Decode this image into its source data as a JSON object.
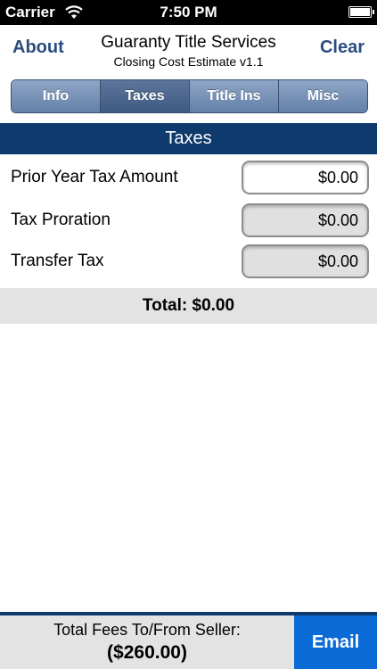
{
  "status_bar": {
    "carrier": "Carrier",
    "time": "7:50 PM"
  },
  "nav": {
    "left_button": "About",
    "title": "Guaranty Title Services",
    "subtitle": "Closing Cost Estimate v1.1",
    "right_button": "Clear"
  },
  "tabs": [
    {
      "label": "Info",
      "active": false
    },
    {
      "label": "Taxes",
      "active": true
    },
    {
      "label": "Title Ins",
      "active": false
    },
    {
      "label": "Misc",
      "active": false
    }
  ],
  "section": {
    "title": "Taxes"
  },
  "rows": [
    {
      "label": "Prior Year Tax Amount",
      "value": "$0.00",
      "editable": true
    },
    {
      "label": "Tax Proration",
      "value": "$0.00",
      "editable": false
    },
    {
      "label": "Transfer Tax",
      "value": "$0.00",
      "editable": false
    }
  ],
  "total": {
    "text": "Total:  $0.00"
  },
  "footer": {
    "label": "Total Fees To/From Seller:",
    "value": "($260.00)",
    "email_button": "Email"
  },
  "colors": {
    "header_blue": "#0f3a6d",
    "nav_text": "#2a4d7f",
    "email_blue": "#0a6ad6",
    "band_gray": "#e3e3e3"
  }
}
